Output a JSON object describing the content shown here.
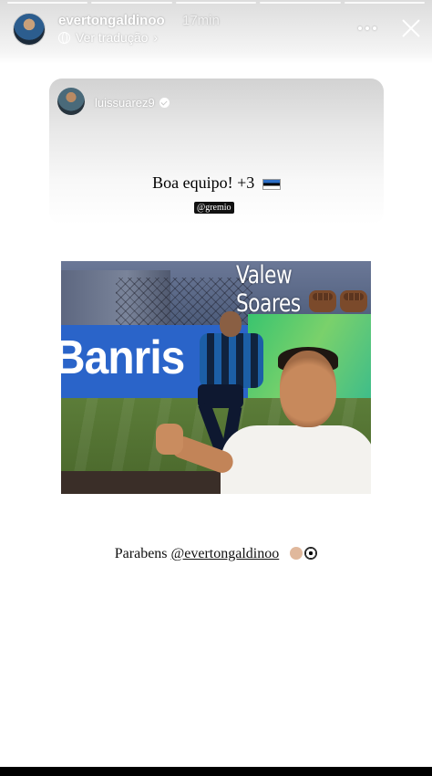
{
  "story": {
    "progress_segments": 5,
    "author": {
      "username": "evertongaldinoo",
      "time": "17min"
    },
    "translate_label": "Ver tradução",
    "translate_chevron": "›"
  },
  "repost_card": {
    "username": "luissuarez9",
    "caption_text": "Boa equipo! +3",
    "mention_chip": "@gremio"
  },
  "photo": {
    "overlay_text": "Valew Soares",
    "banner_text": "Banris"
  },
  "bottom_caption": {
    "prefix": "Parabens ",
    "mention": "@evertongaldinoo"
  },
  "colors": {
    "story_background": "#ffffff",
    "header_overlay_text": "#ffffff",
    "caption_text": "#111111"
  },
  "icons": {
    "more": "more-horizontal-icon",
    "close": "close-icon",
    "translate": "globe-icon",
    "verified": "verified-badge-icon"
  }
}
